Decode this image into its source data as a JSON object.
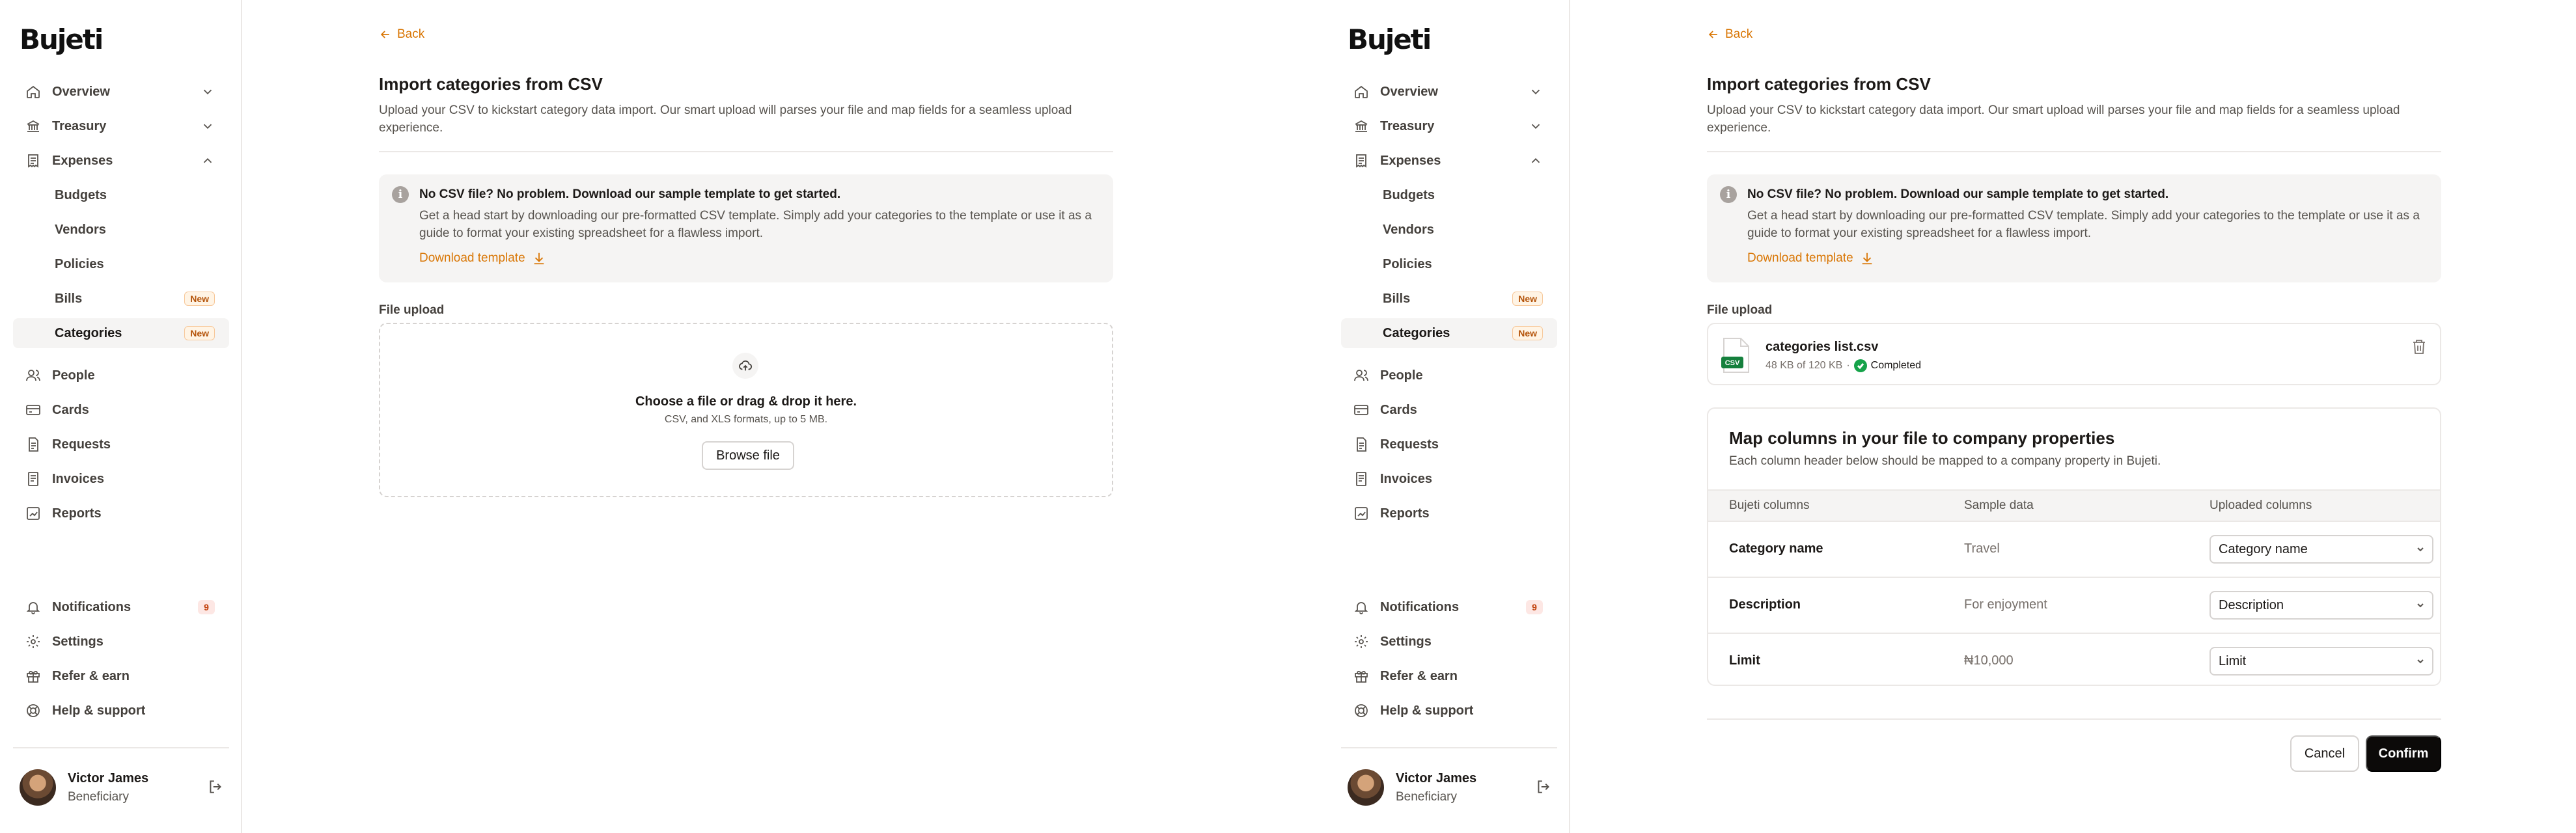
{
  "brand": {
    "logo": "Bujeti"
  },
  "sidebar": {
    "nav": [
      {
        "label": "Overview",
        "icon": "home-icon"
      },
      {
        "label": "Treasury",
        "icon": "bank-icon"
      },
      {
        "label": "Expenses",
        "icon": "receipt-icon"
      }
    ],
    "expenses_sub": [
      {
        "label": "Budgets"
      },
      {
        "label": "Vendors"
      },
      {
        "label": "Policies"
      },
      {
        "label": "Bills",
        "badge": "New"
      },
      {
        "label": "Categories",
        "badge": "New"
      }
    ],
    "nav2": [
      {
        "label": "People",
        "icon": "people-icon"
      },
      {
        "label": "Cards",
        "icon": "card-icon"
      },
      {
        "label": "Requests",
        "icon": "request-icon"
      },
      {
        "label": "Invoices",
        "icon": "invoice-icon"
      },
      {
        "label": "Reports",
        "icon": "reports-icon"
      }
    ],
    "bottom": [
      {
        "label": "Notifications",
        "icon": "bell-icon",
        "count": "9"
      },
      {
        "label": "Settings",
        "icon": "gear-icon"
      },
      {
        "label": "Refer & earn",
        "icon": "gift-icon"
      },
      {
        "label": "Help & support",
        "icon": "lifebuoy-icon"
      }
    ],
    "user": {
      "name": "Victor James",
      "role": "Beneficiary"
    }
  },
  "page": {
    "back_label": "Back",
    "title": "Import categories from CSV",
    "subtitle": "Upload your CSV to kickstart category data import. Our smart upload will parses your file and map fields for a seamless upload experience.",
    "info": {
      "title": "No CSV file? No problem. Download our sample template to get started.",
      "text": "Get a head start by downloading our pre-formatted CSV template. Simply add your categories to the template or use it as a guide to format your existing spreadsheet for a flawless import.",
      "link": "Download template"
    },
    "upload_label": "File upload",
    "dropzone": {
      "title": "Choose a file or drag & drop it here.",
      "sub": "CSV,  and XLS formats, up to 5 MB.",
      "button": "Browse file"
    },
    "file": {
      "name": "categories list.csv",
      "size": "48 KB of 120 KB",
      "separator": "·",
      "status": "Completed",
      "icon_text": "CSV"
    },
    "mapping": {
      "title": "Map columns in your file to company properties",
      "subtitle": "Each column header below should be mapped to a company property in Bujeti.",
      "headers": [
        "Bujeti columns",
        "Sample data",
        "Uploaded columns"
      ],
      "rows": [
        {
          "name": "Category name",
          "sample": "Travel",
          "selected": "Category name"
        },
        {
          "name": "Description",
          "sample": "For enjoyment",
          "selected": "Description"
        },
        {
          "name": "Limit",
          "sample": "₦10,000",
          "selected": "Limit"
        }
      ]
    },
    "actions": {
      "cancel": "Cancel",
      "confirm": "Confirm"
    }
  },
  "colors": {
    "accent": "#d97706",
    "primary_button": "#0c0a09",
    "success": "#16a34a"
  }
}
